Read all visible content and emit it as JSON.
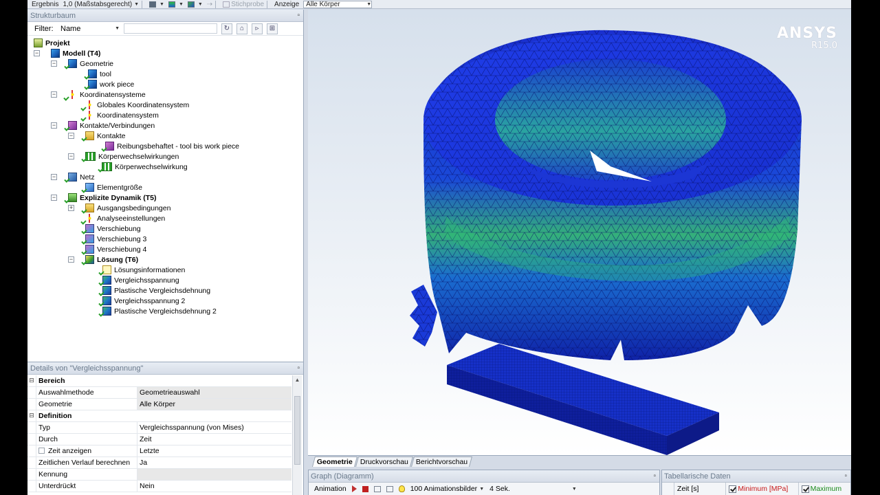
{
  "toolbar": {
    "result_label": "Ergebnis",
    "scale_value": "1,0 (Maßstabsgerecht)",
    "probe_label": "Stichprobe",
    "display_label": "Anzeige",
    "display_value": "Alle Körper"
  },
  "tree_panel": {
    "title": "Strukturbaum",
    "filter_label": "Filter:",
    "filter_value": "Name"
  },
  "tree": {
    "project": "Projekt",
    "model": "Modell (T4)",
    "geometry": "Geometrie",
    "tool": "tool",
    "work_piece": "work piece",
    "coordsystems": "Koordinatensysteme",
    "global_cs": "Globales Koordinatensystem",
    "cs": "Koordinatensystem",
    "contacts_conn": "Kontakte/Verbindungen",
    "contacts": "Kontakte",
    "friction_contact": "Reibungsbehaftet - tool bis work piece",
    "body_interactions": "Körperwechselwirkungen",
    "body_interaction": "Körperwechselwirkung",
    "mesh": "Netz",
    "element_size": "Elementgröße",
    "explicit": "Explizite Dynamik (T5)",
    "initial_conditions": "Ausgangsbedingungen",
    "analysis_settings": "Analyseeinstellungen",
    "disp1": "Verschiebung",
    "disp3": "Verschiebung 3",
    "disp4": "Verschiebung 4",
    "solution": "Lösung (T6)",
    "solution_info": "Lösungsinformationen",
    "eqv_stress": "Vergleichsspannung",
    "plastic_strain": "Plastische Vergleichsdehnung",
    "eqv_stress2": "Vergleichsspannung 2",
    "plastic_strain2": "Plastische Vergleichsdehnung 2"
  },
  "details": {
    "title": "Details von \"Vergleichsspannung\"",
    "cat_scope": "Bereich",
    "scoping_method_k": "Auswahlmethode",
    "scoping_method_v": "Geometrieauswahl",
    "geometry_k": "Geometrie",
    "geometry_v": "Alle Körper",
    "cat_definition": "Definition",
    "type_k": "Typ",
    "type_v": "Vergleichsspannung (von Mises)",
    "by_k": "Durch",
    "by_v": "Zeit",
    "display_time_k": "Zeit anzeigen",
    "display_time_v": "Letzte",
    "time_history_k": "Zeitlichen Verlauf berechnen",
    "time_history_v": "Ja",
    "identifier_k": "Kennung",
    "identifier_v": "",
    "suppressed_k": "Unterdrückt",
    "suppressed_v": "Nein"
  },
  "viewport": {
    "brand": "ANSYS",
    "version": "R15.0"
  },
  "view_tabs": [
    "Geometrie",
    "Druckvorschau",
    "Berichtvorschau"
  ],
  "graph_panel": {
    "title": "Graph (Diagramm)",
    "animation_label": "Animation",
    "frames": "100 Animationsbilder",
    "duration": "4 Sek."
  },
  "table_panel": {
    "title": "Tabellarische Daten",
    "col_time": "Zeit [s]",
    "col_min": "Minimum [MPa]",
    "col_max": "Maximum"
  },
  "colors": {
    "fringe_blue": "#1430c8",
    "fringe_green": "#3cc060",
    "min_color": "#c81818",
    "max_color": "#1a8a1a"
  }
}
